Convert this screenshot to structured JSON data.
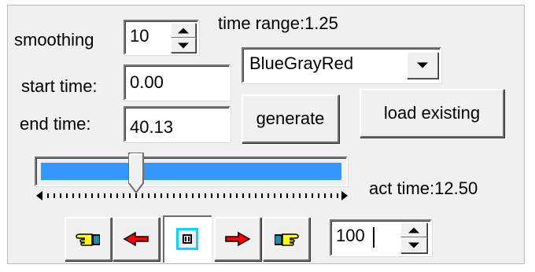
{
  "smoothing": {
    "label": "smoothing",
    "value": "10"
  },
  "time_range": {
    "label": "time range:1.25"
  },
  "start_time": {
    "label": "start time:",
    "value": "0.00"
  },
  "end_time": {
    "label": "end time:",
    "value": "40.13"
  },
  "colormap": {
    "selected": "BlueGrayRed"
  },
  "buttons": {
    "generate": "generate",
    "load_existing": "load existing"
  },
  "slider": {
    "progress": 0.31
  },
  "act_time": {
    "label": "act time:12.50"
  },
  "speed": {
    "value": "100"
  },
  "colors": {
    "slider_fill": "#3399ff",
    "active_border": "#00d8ff",
    "arrow_red": "#ff0000",
    "hand_yellow": "#ffff00"
  },
  "icons": [
    "hand-left-icon",
    "arrow-left-icon",
    "pause-icon",
    "arrow-right-icon",
    "hand-right-icon"
  ]
}
